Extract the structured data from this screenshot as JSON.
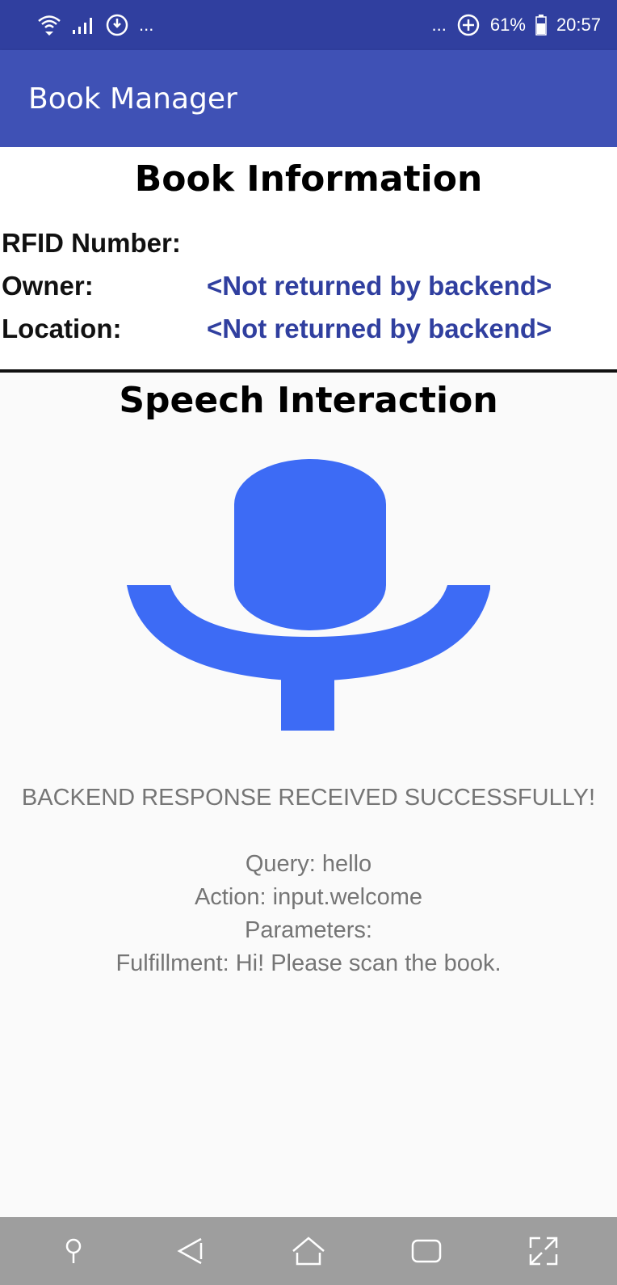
{
  "status_bar": {
    "left_dots": "...",
    "right_dots": "...",
    "battery_percent": "61%",
    "time": "20:57",
    "icons": [
      "wifi-icon",
      "signal-icon",
      "sync-icon",
      "data-saver-icon",
      "battery-icon"
    ]
  },
  "app_bar": {
    "title": "Book Manager"
  },
  "book_info": {
    "heading": "Book Information",
    "rfid_label": "RFID Number:",
    "rfid_value": "",
    "owner_label": "Owner:",
    "owner_value": "<Not returned by backend>",
    "location_label": "Location:",
    "location_value": "<Not returned by backend>"
  },
  "speech": {
    "heading": "Speech Interaction",
    "mic_icon": "microphone-icon",
    "mic_color": "#3d6bf5"
  },
  "response": {
    "status": "BACKEND RESPONSE RECEIVED SUCCESSFULLY!",
    "query": "Query: hello",
    "action": "Action: input.welcome",
    "parameters": "Parameters:",
    "fulfillment": "Fulfillment: Hi! Please scan the book."
  },
  "nav_bar": {
    "icons": [
      "pin-icon",
      "back-icon",
      "home-icon",
      "recents-icon",
      "expand-icon"
    ]
  },
  "colors": {
    "status_bar": "#303f9f",
    "app_bar": "#3f51b5",
    "value_text": "#303f9f",
    "response_text": "#757575",
    "nav_bar": "#9e9e9e"
  }
}
